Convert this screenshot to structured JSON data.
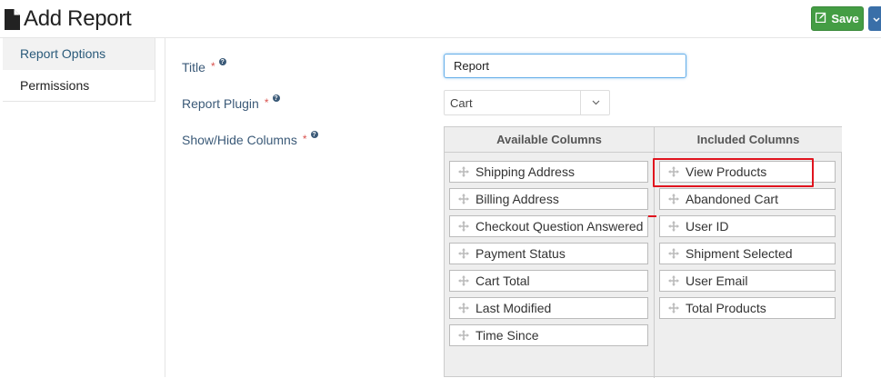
{
  "header": {
    "title": "Add Report",
    "save_label": "Save"
  },
  "sidebar": {
    "items": [
      {
        "label": "Report Options",
        "active": true
      },
      {
        "label": "Permissions",
        "active": false
      }
    ]
  },
  "form": {
    "title_label": "Title",
    "title_value": "Report",
    "plugin_label": "Report Plugin",
    "plugin_value": "Cart",
    "columns_label": "Show/Hide Columns",
    "required_mark": "*",
    "help_mark": "?"
  },
  "columns": {
    "available_header": "Available Columns",
    "included_header": "Included Columns",
    "available": [
      "Shipping Address",
      "Billing Address",
      "Checkout Question Answered",
      "Payment Status",
      "Cart Total",
      "Last Modified",
      "Time Since"
    ],
    "included": [
      "View Products",
      "Abandoned Cart",
      "User ID",
      "Shipment Selected",
      "User Email",
      "Total Products"
    ]
  },
  "colors": {
    "save": "#449d44",
    "highlight": "#e0141e",
    "label": "#3b5a78"
  }
}
